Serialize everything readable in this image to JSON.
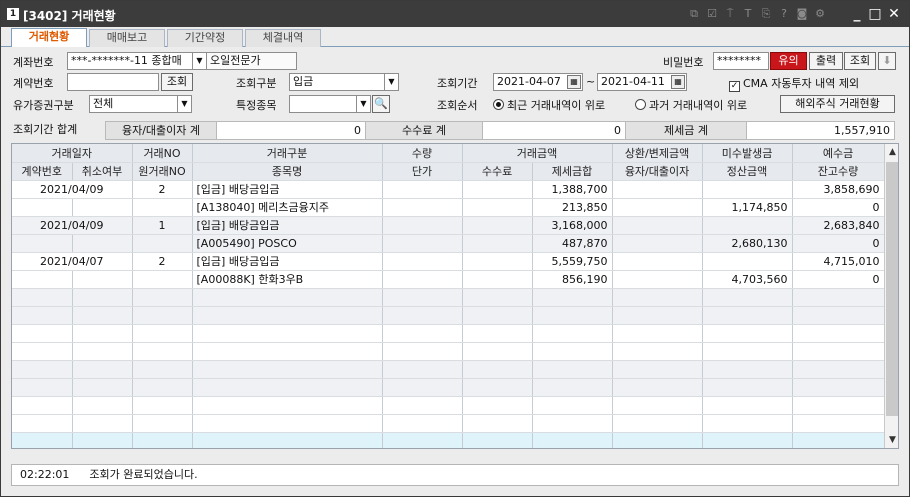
{
  "window": {
    "app_icon": "1",
    "title": "[3402] 거래현황",
    "toolbar_icons": [
      "link-icon",
      "checkbox-icon",
      "pin-icon",
      "text-icon",
      "copy-icon",
      "help-icon",
      "camera-icon",
      "settings-icon"
    ],
    "controls": [
      "_",
      "□",
      "✕"
    ]
  },
  "tabs": [
    "거래현황",
    "매매보고",
    "기간약정",
    "체결내역"
  ],
  "filters": {
    "account_label": "계좌번호",
    "account_value": "***-*******-11 종합매",
    "account_name": "오일전문가",
    "password_label": "비밀번호",
    "password_value": "********",
    "notice_btn": "유의",
    "print_btn": "출력",
    "search_btn": "조회",
    "contract_label": "계약번호",
    "contract_search_btn": "조회",
    "query_type_label": "조회구분",
    "query_type_value": "입금",
    "period_label": "조회기간",
    "date_from": "2021-04-07",
    "date_sep": "~",
    "date_to": "2021-04-11",
    "cma_label": "CMA 자동투자 내역 제외",
    "security_label": "유가증권구분",
    "security_value": "전체",
    "item_label": "특정종목",
    "order_label": "조회순서",
    "order_recent": "최근 거래내역이 위로",
    "order_past": "과거 거래내역이 위로",
    "overseas_btn": "해외주식 거래현황"
  },
  "summary": {
    "period_total": "조회기간 합계",
    "interest_label": "융자/대출이자 계",
    "interest_value": "0",
    "fee_label": "수수료 계",
    "fee_value": "0",
    "tax_label": "제세금 계",
    "tax_value": "1,557,910"
  },
  "grid": {
    "header1": [
      "거래일자",
      "거래NO",
      "거래구분",
      "수량",
      "거래금액",
      "상환/변제금액",
      "미수발생금",
      "예수금"
    ],
    "header2": [
      "계약번호",
      "취소여부",
      "원거래NO",
      "종목명",
      "단가",
      "수수료",
      "제세금합",
      "융자/대출이자",
      "정산금액",
      "잔고수량"
    ],
    "rows": [
      [
        "2021/04/09",
        "",
        "2",
        "[입금] 배당금입금",
        "",
        "",
        "1,388,700",
        "",
        "",
        "3,858,690"
      ],
      [
        "",
        "",
        "",
        "[A138040] 메리츠금융지주",
        "",
        "",
        "213,850",
        "",
        "1,174,850",
        "0"
      ],
      [
        "2021/04/09",
        "",
        "1",
        "[입금] 배당금입금",
        "",
        "",
        "3,168,000",
        "",
        "",
        "2,683,840"
      ],
      [
        "",
        "",
        "",
        "[A005490] POSCO",
        "",
        "",
        "487,870",
        "",
        "2,680,130",
        "0"
      ],
      [
        "2021/04/07",
        "",
        "2",
        "[입금] 배당금입금",
        "",
        "",
        "5,559,750",
        "",
        "",
        "4,715,010"
      ],
      [
        "",
        "",
        "",
        "[A00088K] 한화3우B",
        "",
        "",
        "856,190",
        "",
        "4,703,560",
        "0"
      ]
    ]
  },
  "status": {
    "time": "02:22:01",
    "message": "조회가 완료되었습니다."
  }
}
